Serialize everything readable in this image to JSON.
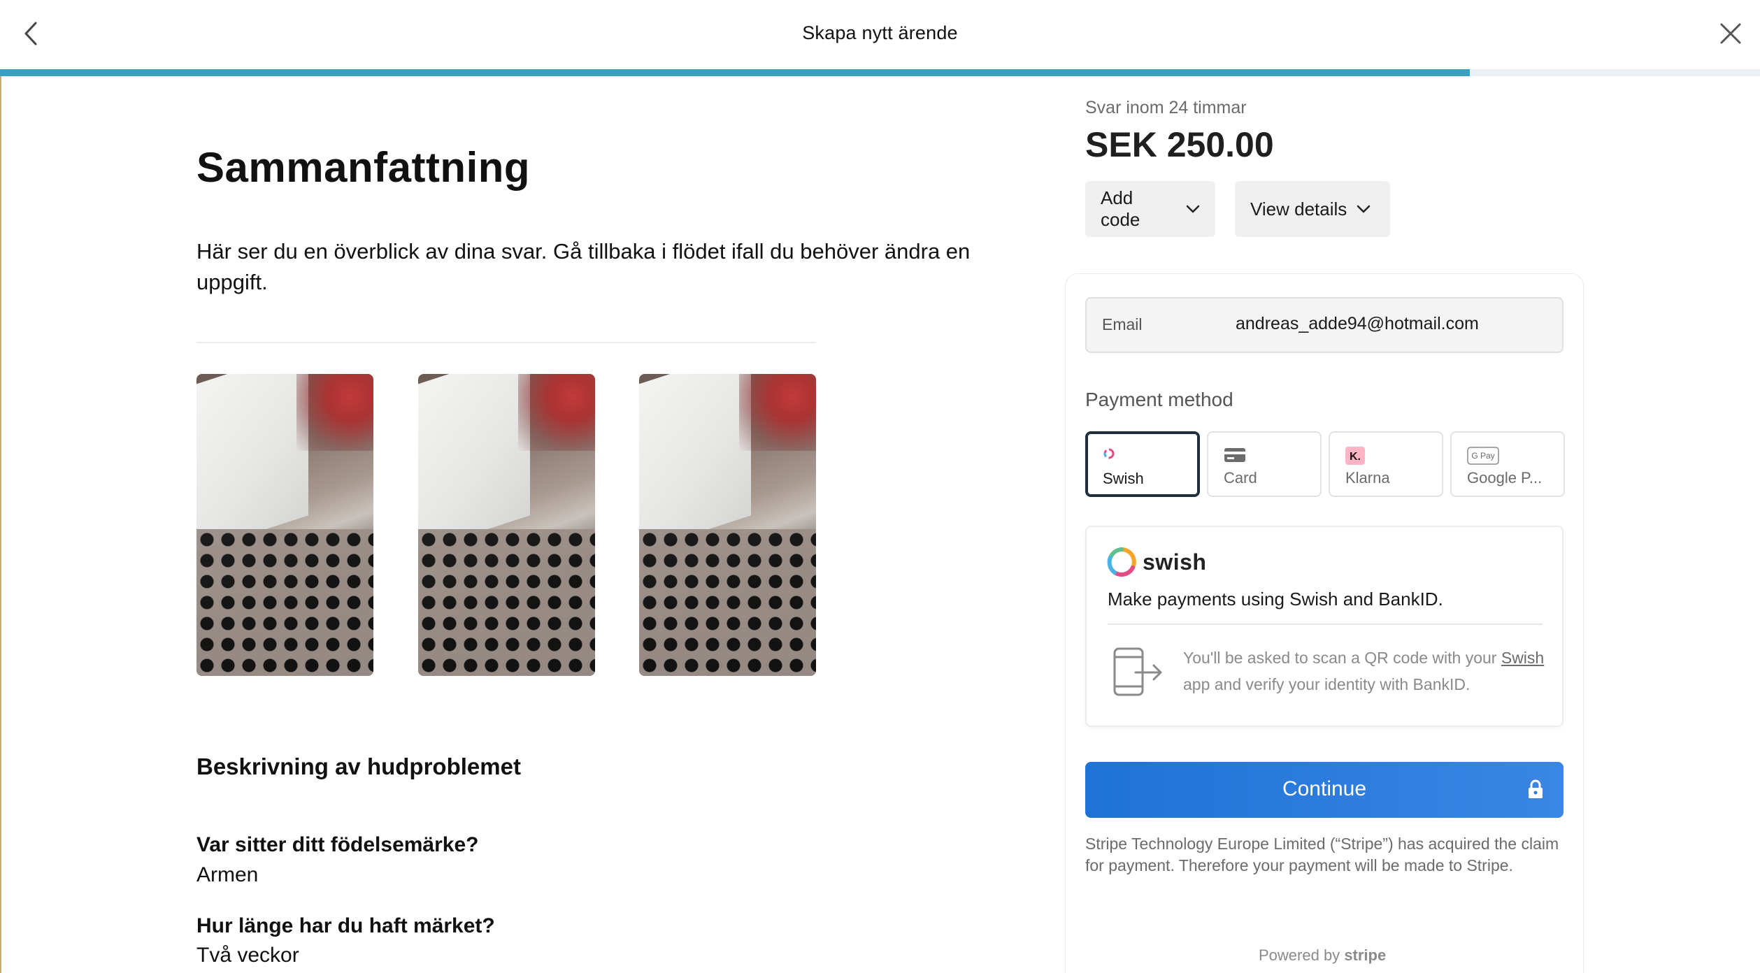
{
  "header": {
    "title": "Skapa nytt ärende",
    "progress_percent": 83.5
  },
  "summary": {
    "title": "Sammanfattning",
    "text": "Här ser du en överblick av dina svar. Gå tillbaka i flödet ifall du behöver ändra en uppgift.",
    "photo_count": 3
  },
  "description": {
    "section_title": "Beskrivning av hudproblemet",
    "questions": [
      {
        "question": "Var sitter ditt födelsemärke?",
        "answer": "Armen"
      },
      {
        "question": "Hur länge har du haft märket?",
        "answer": "Två veckor"
      }
    ]
  },
  "checkout": {
    "response_time": "Svar inom 24 timmar",
    "price": "SEK 250.00",
    "add_code_label": "Add code",
    "view_details_label": "View details",
    "email_label": "Email",
    "email_value": "andreas_adde94@hotmail.com",
    "payment_method_label": "Payment method",
    "methods": [
      {
        "name": "Swish",
        "selected": true
      },
      {
        "name": "Card",
        "selected": false
      },
      {
        "name": "Klarna",
        "selected": false
      },
      {
        "name": "Google P...",
        "selected": false
      }
    ],
    "swish": {
      "brand": "swish",
      "description": "Make payments using Swish and BankID.",
      "info_prefix": "You'll be asked to scan a QR code with your",
      "info_link": "Swish",
      "info_suffix": "app and verify your identity with BankID."
    },
    "continue_label": "Continue",
    "legal": "Stripe Technology Europe Limited (“Stripe”) has acquired the claim for payment. Therefore your payment will be made to Stripe.",
    "powered_by": "Powered by",
    "powered_brand": "stripe"
  },
  "colors": {
    "progress": "#3aa0c2",
    "continue": "#1f72d6",
    "selected_border": "#1f2d3d"
  }
}
